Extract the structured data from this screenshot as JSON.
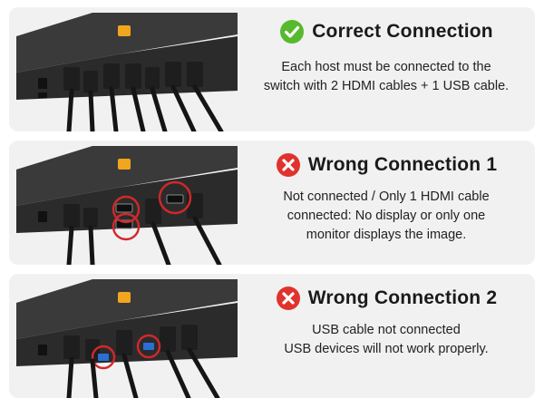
{
  "colors": {
    "panel_bg": "#f1f1f1",
    "correct_green": "#57b92e",
    "wrong_red": "#e0332d",
    "highlight_circle": "#d3272b",
    "device_body": "#2e2e2e",
    "brand_orange": "#f2a51e"
  },
  "sections": [
    {
      "status": "correct",
      "icon": "check-circle-icon",
      "title": "Correct Connection",
      "description": [
        "Each host must be connected to the",
        "switch with 2 HDMI cables + 1 USB cable."
      ]
    },
    {
      "status": "wrong",
      "icon": "x-circle-icon",
      "title": "Wrong Connection 1",
      "description": [
        "Not connected / Only 1 HDMI cable",
        "connected: No display or only one",
        "monitor displays the image."
      ]
    },
    {
      "status": "wrong",
      "icon": "x-circle-icon",
      "title": "Wrong Connection 2",
      "description": [
        "USB cable not connected",
        "USB devices will not work properly."
      ]
    }
  ]
}
